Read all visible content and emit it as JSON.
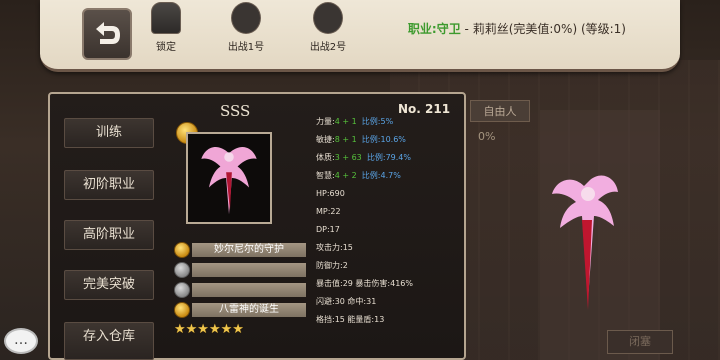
{
  "topbar": {
    "slots": [
      {
        "label": "锁定",
        "icon": "padlock-icon"
      },
      {
        "label": "出战1号",
        "icon": "character-avatar-icon"
      },
      {
        "label": "出战2号",
        "icon": "character-avatar-icon"
      }
    ],
    "class_prefix": "职业:守卫",
    "class_rest": " - 莉莉丝(完美值:0%) (等级:1)"
  },
  "menu": [
    "训练",
    "初阶职业",
    "高阶职业",
    "完美突破",
    "存入仓库"
  ],
  "card": {
    "rank": "SSS",
    "number": "No. 211",
    "gems": [
      {
        "filled": true,
        "label": "妙尔尼尔的守护"
      },
      {
        "filled": false,
        "label": ""
      },
      {
        "filled": false,
        "label": ""
      },
      {
        "filled": true,
        "label": "八雷神的诞生"
      }
    ],
    "stars": "★★★★★★",
    "star_count": 6
  },
  "stats": {
    "str": {
      "label": "力量:",
      "base": "4",
      "plus": "+ 1",
      "ratio": "比例:5%"
    },
    "agi": {
      "label": "敏捷:",
      "base": "8",
      "plus": "+ 1",
      "ratio": "比例:10.6%"
    },
    "con": {
      "label": "体质:",
      "base": "3",
      "plus": "+ 63",
      "ratio": "比例:79.4%"
    },
    "int": {
      "label": "智慧:",
      "base": "4",
      "plus": "+ 2",
      "ratio": "比例:4.7%"
    },
    "hp": "HP:690",
    "mp": "MP:22",
    "dp": "DP:17",
    "atk": "攻击力:15",
    "def": "防御力:2",
    "crit": "暴击值:29  暴击伤害:416%",
    "dodge": "闪避:30  命中:31",
    "block": "格挡:15  能量盾:13"
  },
  "background": {
    "tag": "自由人",
    "pct": "0%",
    "close": "闭塞"
  },
  "colors": {
    "green": "#56c13b",
    "blue": "#5aa4e6",
    "gold": "#f0c64c"
  }
}
